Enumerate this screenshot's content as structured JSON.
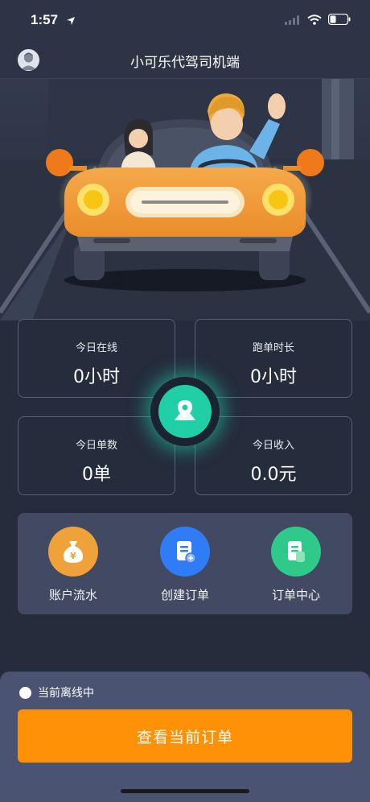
{
  "status_bar": {
    "time": "1:57"
  },
  "header": {
    "title": "小可乐代驾司机端"
  },
  "stats": [
    {
      "label": "今日在线",
      "value": "0小时"
    },
    {
      "label": "跑单时长",
      "value": "0小时"
    },
    {
      "label": "今日单数",
      "value": "0单"
    },
    {
      "label": "今日收入",
      "value": "0.0元"
    }
  ],
  "actions": [
    {
      "label": "账户流水",
      "icon": "money-bag-icon",
      "color": "#f0a23a"
    },
    {
      "label": "创建订单",
      "icon": "create-order-icon",
      "color": "#2f7cf6"
    },
    {
      "label": "订单中心",
      "icon": "order-center-icon",
      "color": "#2fc98a"
    }
  ],
  "bottom": {
    "status_text": "当前离线中",
    "main_button": "查看当前订单"
  },
  "colors": {
    "background": "#252c3b",
    "accent_orange": "#fe9106",
    "accent_teal": "#20cfa6"
  }
}
